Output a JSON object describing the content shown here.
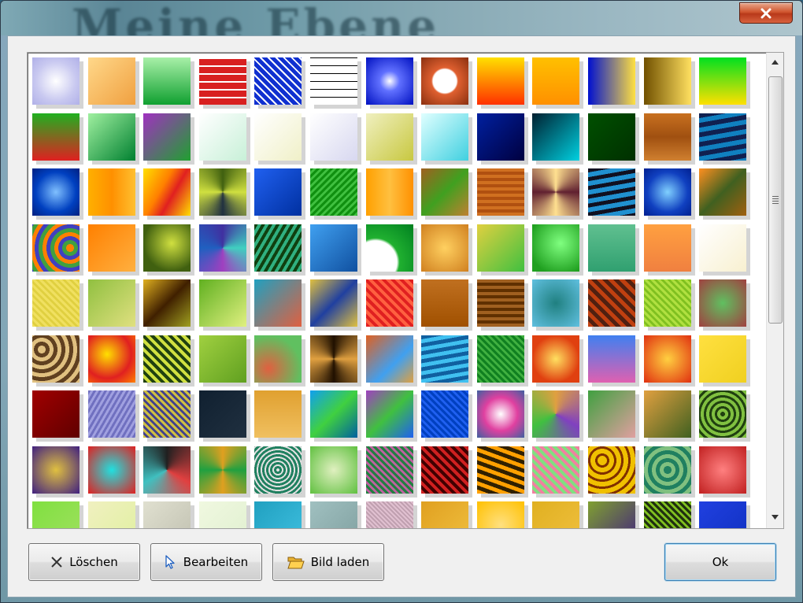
{
  "buttons": {
    "delete": "Löschen",
    "edit": "Bearbeiten",
    "load_image": "Bild laden",
    "ok": "Ok"
  },
  "icons": {
    "close": "close-icon",
    "delete": "x-mark-icon",
    "edit": "cursor-arrow-icon",
    "load_image": "folder-open-icon",
    "scroll_up": "arrow-up-icon",
    "scroll_down": "arrow-down-icon"
  },
  "colors": {
    "close_button": "#c8452a",
    "ok_border": "#3c7fb1",
    "dialog_background": "#f0f0f0",
    "grid_background": "#ffffff"
  },
  "scroll": {
    "position": 0,
    "visible_fraction": 0.62
  },
  "textures": [
    "radial-gradient(circle, #ffffff 0%, #c8c8f0 60%, #b0b0e8 100%)",
    "linear-gradient(135deg, #ffd88a 0%, #f0a040 100%)",
    "linear-gradient(180deg, #a8f0a8 0%, #10a030 100%)",
    "repeating-linear-gradient(0deg, #d82020 0 8px, #ffffff 8px 10px)",
    "repeating-linear-gradient(45deg, #1030d0 0 5px, #ffffff 5px 7px), repeating-linear-gradient(-45deg, #1030d0 0 5px, #ffffff 5px 7px)",
    "repeating-linear-gradient(0deg, #ffffff 0 9px, #000000 9px 10px), repeating-linear-gradient(90deg, #ffffff 0 9px, #000000 9px 10px)",
    "radial-gradient(circle, #ffffff 0%, #6070ff 30%, #0010c0 100%)",
    "radial-gradient(circle, #ffffff 0%, #ffffff 35%, #e06030 40%, #8a3010 100%)",
    "linear-gradient(180deg, #ffe000 0%, #ff3000 100%)",
    "linear-gradient(180deg, #ffc000 0%, #ff9000 100%)",
    "linear-gradient(90deg, #0010d0 0%, #ffe040 100%)",
    "linear-gradient(90deg, #705000 0%, #ffe060 100%)",
    "linear-gradient(180deg, #00e020 0%, #ffe000 100%)",
    "linear-gradient(180deg, #20b020 0%, #e02020 100%)",
    "linear-gradient(135deg, #a0f0a0 0%, #008030 100%)",
    "linear-gradient(135deg, #a030c0 0%, #20a030 100%)",
    "linear-gradient(135deg, #ffffff 0%, #c8f0d8 100%)",
    "linear-gradient(135deg, #ffffff 0%, #f0f0c8 100%)",
    "linear-gradient(135deg, #ffffff 0%, #d8d8f0 100%)",
    "linear-gradient(135deg, #f0f0c0 0%, #c8c840 100%)",
    "linear-gradient(135deg, #e0ffff 0%, #40d0e0 100%)",
    "linear-gradient(135deg, #0020a0 0%, #000040 100%)",
    "linear-gradient(135deg, #002030 0%, #00d0e0 100%)",
    "linear-gradient(135deg, #005000 0%, #003000 100%)",
    "linear-gradient(180deg, #c87020 0%, #a05010 50%, #d08030 100%)",
    "repeating-linear-gradient(170deg, #102050 0 6px, #1080c0 6px 12px)",
    "radial-gradient(circle, #80c0ff 0%, #0040c0 60%, #002080 100%)",
    "linear-gradient(90deg, #ffb000 0%, #ff9000 50%, #ffc030 100%)",
    "linear-gradient(120deg, #ffe000 0%, #ff8000 40%, #e02020 60%, #ffe000 100%)",
    "conic-gradient(#406010, #d0e040, #203040, #d0e040, #406010)",
    "linear-gradient(135deg, #2060f0 0%, #0030a0 100%)",
    "repeating-linear-gradient(135deg, #109010 0 3px, #40c040 3px 6px)",
    "linear-gradient(90deg, #ffa000 0%, #ffc040 50%, #ff9000 100%)",
    "linear-gradient(135deg, #a06020 0%, #40a020 50%, #c08030 100%)",
    "repeating-linear-gradient(0deg, #d07020 0 4px, #b05010 4px 8px)",
    "conic-gradient(from 90deg, #602030, #ffe090, #602030, #ffe090, #602030)",
    "repeating-linear-gradient(170deg, #101020 0 5px, #2090d0 5px 11px)",
    "radial-gradient(circle, #80d0ff 0%, #1040c0 60%, #002090 100%)",
    "linear-gradient(135deg, #ff9020 0%, #406020 50%, #a06010 100%)",
    "repeating-radial-gradient(circle at 80% 50%, #ff8000 0 5px, #40a040 5px 10px, #4040c0 10px 15px)",
    "linear-gradient(135deg, #ff8000 0%, #ffb040 100%)",
    "radial-gradient(circle at 60% 40%, #d0e040 0%, #406010 70%)",
    "conic-gradient(#4030a0, #40d0c0, #a040c0, #2060c0, #4030a0)",
    "repeating-linear-gradient(120deg, #104010 0 4px, #30b080 4px 8px)",
    "linear-gradient(135deg, #40a0f0 0%, #1050a0 100%)",
    "radial-gradient(circle at 20% 80%, #ffffff 0%, #ffffff 40%, #20b030 45%, #008020 100%)",
    "radial-gradient(circle, #ffd060 0%, #d08020 100%)",
    "linear-gradient(135deg, #e0d040 0%, #40c040 100%)",
    "radial-gradient(circle at 60% 40%, #80ff80 0%, #20a020 80%)",
    "linear-gradient(180deg, #60c090 0%, #30a070 100%)",
    "linear-gradient(180deg, #ffa040 0%, #f08040 100%)",
    "linear-gradient(135deg, #ffffff 0%, #f8f0d0 100%)",
    "repeating-linear-gradient(45deg, #f0e060 0 3px, #e0d040 3px 6px)",
    "linear-gradient(135deg, #90c040 0%, #e0e080 100%)",
    "linear-gradient(135deg, #e0b020 0%, #402000 50%, #a0a020 100%)",
    "linear-gradient(135deg, #60b020 0%, #e0f080 100%)",
    "linear-gradient(135deg, #20a0c0 0%, #e06040 100%)",
    "linear-gradient(135deg, #e0c040 0%, #2040a0 50%, #e0c040 100%)",
    "repeating-linear-gradient(45deg, #e02020 0 4px, #ff6040 4px 8px)",
    "linear-gradient(180deg, #c07020 0%, #a05000 100%)",
    "repeating-linear-gradient(0deg, #a06020 0 4px, #603000 4px 8px)",
    "radial-gradient(circle, #208080 0%, #60c0e0 100%)",
    "repeating-linear-gradient(45deg, #c04010 0 5px, #502010 5px 10px)",
    "repeating-linear-gradient(45deg, #b0e040 0 3px, #80c020 3px 6px)",
    "radial-gradient(circle, #60c060 0%, #a04040 100%)",
    "repeating-radial-gradient(circle at 20% 30%, #e0c080 0 5px, #604020 5px 10px)",
    "radial-gradient(circle at 40% 40%, #ffe000 0%, #e02020 60%, #ff8000 100%)",
    "repeating-linear-gradient(45deg, #204010 0 4px, #d0e040 4px 8px)",
    "linear-gradient(135deg, #a0d040 0%, #60a020 100%)",
    "radial-gradient(circle at 30% 70%, #e06040 0%, #60c060 70%)",
    "conic-gradient(#201000, #e0a040, #201000, #e0a040, #201000)",
    "linear-gradient(135deg, #e06020 0%, #40a0f0 60%, #e0a040 100%)",
    "repeating-linear-gradient(170deg, #1060a0 0 5px, #40c0f0 5px 10px)",
    "repeating-linear-gradient(45deg, #108020 0 3px, #40b040 3px 6px)",
    "radial-gradient(circle, #ffe060 0%, #e04010 70%)",
    "linear-gradient(180deg, #4080f0 0%, #e060b0 100%)",
    "radial-gradient(circle, #ffd040 0%, #e03010 100%)",
    "linear-gradient(135deg, #ffe040 0%, #f0d020 100%)",
    "linear-gradient(135deg, #a00000 0%, #600000 100%)",
    "repeating-linear-gradient(120deg, #7070c0 0 3px, #a0a0e0 3px 6px)",
    "repeating-linear-gradient(45deg, #d0c040 0 3px, #404090 3px 6px)",
    "linear-gradient(135deg, #102030 0%, #203040 100%)",
    "linear-gradient(180deg, #e0a030 0%, #f0c060 100%)",
    "linear-gradient(135deg, #10a0f0 0%, #40d040 50%, #0060a0 100%)",
    "linear-gradient(135deg, #a040c0 0%, #40c040 50%, #2060f0 100%)",
    "repeating-linear-gradient(45deg, #0040c0 0 3px, #2060f0 3px 6px)",
    "radial-gradient(circle, #ffffff 0%, #e040a0 50%, #4060a0 100%)",
    "conic-gradient(#e0a040, #8040c0, #40c040, #e0a040)",
    "linear-gradient(135deg, #40a040 0%, #e0a0a0 100%)",
    "linear-gradient(135deg, #e0a040 0%, #406020 100%)",
    "repeating-radial-gradient(circle, #204010 0 3px, #80c040 3px 7px)",
    "radial-gradient(circle, #e0c040 0%, #402080 100%)",
    "radial-gradient(circle, #20e0e0 0%, #e02020 100%)",
    "conic-gradient(#202020, #e04040, #40c0c0, #202020)",
    "conic-gradient(#e0a020, #20a040, #e0a020, #20a040, #e0a020)",
    "repeating-radial-gradient(circle, #e0e0e0 0 2px, #208060 2px 5px)",
    "radial-gradient(circle, #e0f0c0 0%, #60c040 100%)",
    "repeating-linear-gradient(45deg, #208040 0 3px, #c060a0 3px 6px)",
    "repeating-linear-gradient(45deg, #d02020 0 4px, #400000 4px 8px)",
    "repeating-linear-gradient(20deg, #ffa000 0 5px, #302000 5px 10px)",
    "repeating-linear-gradient(45deg, #f080a0 0 4px, #80e080 4px 8px)",
    "repeating-radial-gradient(circle at 30% 30%, #f0c000 0 6px, #803000 6px 9px)",
    "repeating-radial-gradient(circle, #208060 0 5px, #80c080 5px 10px)",
    "radial-gradient(circle, #ff8080 0%, #c02020 100%)",
    "linear-gradient(135deg, #80e040 0%, #a0e060 100%)",
    "linear-gradient(135deg, #f0f0c0 0%, #e0f0a0 100%)",
    "linear-gradient(135deg, #e0e0d0 0%, #c0c0b0 100%)",
    "linear-gradient(135deg, #f0f8e0 0%, #e0f0d0 100%)",
    "linear-gradient(135deg, #20a0c0 0%, #40c0e0 100%)",
    "linear-gradient(135deg, #a0c0c0 0%, #80a0a0 100%)",
    "repeating-linear-gradient(45deg, #c0a0b0 0 2px, #e0c0d0 2px 4px)",
    "linear-gradient(135deg, #e0a020 0%, #f0c040 100%)",
    "radial-gradient(circle, #ffe080 0%, #ffc000 100%)",
    "linear-gradient(135deg, #e0b020 0%, #f0c040 100%)",
    "linear-gradient(135deg, #80a030 0%, #402080 100%)",
    "repeating-linear-gradient(45deg, #203010 0 3px, #80c020 3px 6px)",
    "linear-gradient(135deg, #2040e0 0%, #1030c0 100%)"
  ]
}
